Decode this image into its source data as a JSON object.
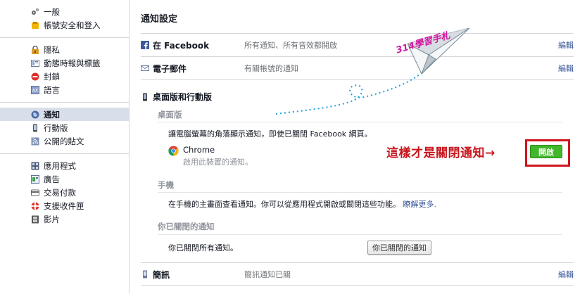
{
  "sidebar": {
    "groups": [
      [
        {
          "label": "一般",
          "icon": "gears-icon",
          "active": false
        },
        {
          "label": "帳號安全和登入",
          "icon": "badge-icon",
          "active": false
        }
      ],
      [
        {
          "label": "隱私",
          "icon": "lock-icon",
          "active": false
        },
        {
          "label": "動態時報與標籤",
          "icon": "timeline-icon",
          "active": false
        },
        {
          "label": "封鎖",
          "icon": "block-icon",
          "active": false
        },
        {
          "label": "語言",
          "icon": "language-icon",
          "active": false
        }
      ],
      [
        {
          "label": "通知",
          "icon": "globe-icon",
          "active": true
        },
        {
          "label": "行動版",
          "icon": "mobile-icon",
          "active": false
        },
        {
          "label": "公開的貼文",
          "icon": "rss-icon",
          "active": false
        }
      ],
      [
        {
          "label": "應用程式",
          "icon": "apps-icon",
          "active": false
        },
        {
          "label": "廣告",
          "icon": "ads-icon",
          "active": false
        },
        {
          "label": "交易付款",
          "icon": "payment-icon",
          "active": false
        },
        {
          "label": "支援收件匣",
          "icon": "lifebuoy-icon",
          "active": false
        },
        {
          "label": "影片",
          "icon": "film-icon",
          "active": false
        }
      ]
    ]
  },
  "main": {
    "title": "通知設定",
    "facebook": {
      "label": "在 Facebook",
      "value": "所有通知、所有音效都開啟",
      "edit": "編輯"
    },
    "email": {
      "label": "電子郵件",
      "value": "有關帳號的通知",
      "edit": "編輯"
    },
    "desktop_mobile": {
      "label": "桌面版和行動版"
    },
    "desktop": {
      "title": "桌面版",
      "desc": "讓電腦螢幕的角落顯示通知，即使已關閉 Facebook 網頁。",
      "browser_name": "Chrome",
      "browser_desc": "啟用此裝置的通知。",
      "enable_button": "開啟"
    },
    "mobile": {
      "title": "手機",
      "desc": "在手機的主畫面查看通知。你可以從應用程式開啟或關閉這些功能。",
      "learn_more": "瞭解更多."
    },
    "turned_off": {
      "title": "你已關閉的通知",
      "desc": "你已關閉所有通知。",
      "button": "你已關閉的通知"
    },
    "sms": {
      "label": "簡訊",
      "value": "簡訊通知已關",
      "edit": "編輯"
    }
  },
  "overlay": {
    "annotation": "這樣才是關閉通知→",
    "watermark": "314學習手札",
    "colors": {
      "red": "#c8161d",
      "green": "#42b72a",
      "watermark": "#d418a0",
      "link": "#3b5998"
    }
  }
}
